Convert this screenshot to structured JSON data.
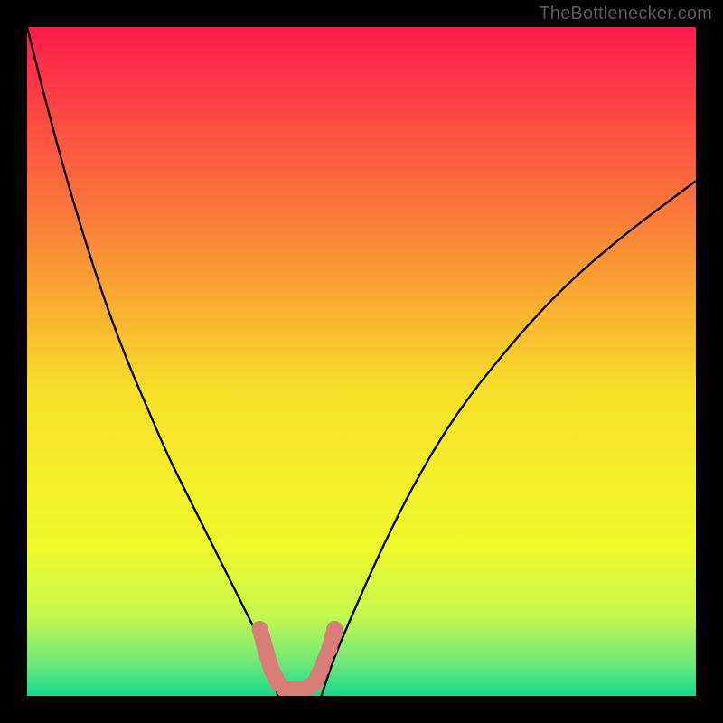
{
  "watermark": "TheBottlenecker.com",
  "chart_data": {
    "type": "line",
    "title": "",
    "xlabel": "",
    "ylabel": "",
    "xlim": [
      0,
      100
    ],
    "ylim": [
      0,
      100
    ],
    "gradient_stops": [
      {
        "offset": 0,
        "color": "#fd1c4b"
      },
      {
        "offset": 0.28,
        "color": "#fb7a3a"
      },
      {
        "offset": 0.55,
        "color": "#f8e229"
      },
      {
        "offset": 0.78,
        "color": "#eef92b"
      },
      {
        "offset": 0.88,
        "color": "#c6f74f"
      },
      {
        "offset": 0.95,
        "color": "#6fe879"
      },
      {
        "offset": 1.0,
        "color": "#16d98d"
      }
    ],
    "series": [
      {
        "name": "curve-left",
        "stroke": "#000000",
        "x": [
          0,
          3,
          6,
          9,
          12,
          15,
          18,
          21,
          24,
          27,
          30,
          33,
          34.5,
          36,
          37.5
        ],
        "y": [
          100,
          88,
          77,
          67,
          58,
          50,
          43,
          36,
          30,
          24,
          18,
          12,
          9,
          5,
          0
        ]
      },
      {
        "name": "curve-right",
        "stroke": "#000000",
        "x": [
          44,
          46,
          49,
          53,
          58,
          64,
          71,
          79,
          88,
          100
        ],
        "y": [
          0,
          6,
          13,
          22,
          32,
          42,
          51,
          60,
          68,
          77
        ]
      },
      {
        "name": "marker-cluster",
        "stroke": "#d97d79",
        "fill": "#d97d79",
        "type": "scatter",
        "x": [
          34.8,
          35.5,
          36.5,
          37.5,
          38.5,
          39.5,
          40.5,
          41.5,
          43.0,
          44.0,
          45.2,
          46.0
        ],
        "y": [
          10.0,
          7.5,
          4.0,
          2.0,
          1.0,
          1.0,
          1.0,
          1.0,
          2.0,
          4.0,
          7.0,
          10.0
        ]
      }
    ]
  }
}
